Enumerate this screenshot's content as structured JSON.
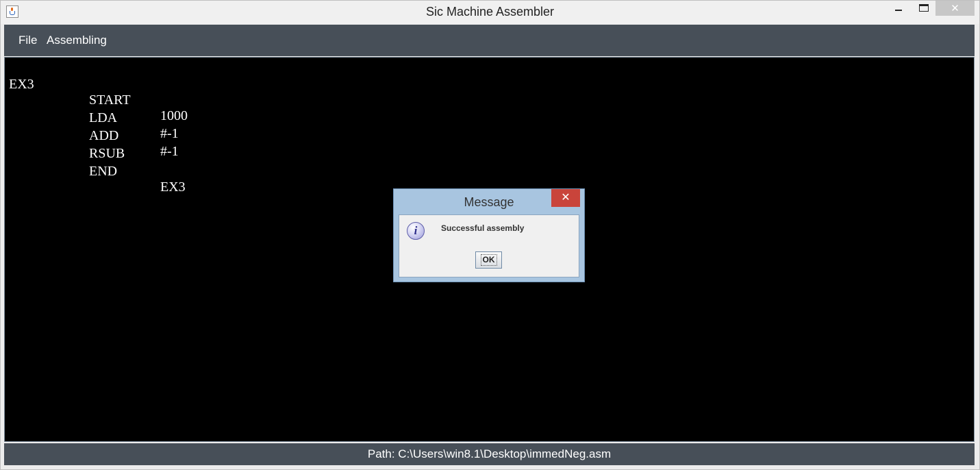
{
  "window": {
    "title": "Sic Machine Assembler",
    "close_glyph": "✕",
    "app_icon": "java-cup-icon"
  },
  "menu": {
    "items": [
      "File",
      "Assembling"
    ]
  },
  "editor": {
    "lines": [
      [
        "EX3",
        "START",
        "1000"
      ],
      [
        "",
        "LDA",
        "#-1"
      ],
      [
        "",
        "ADD",
        "#-1"
      ],
      [
        "",
        "RSUB",
        ""
      ],
      [
        "",
        "END",
        "EX3"
      ]
    ]
  },
  "status": {
    "path": "Path: C:\\Users\\win8.1\\Desktop\\immedNeg.asm"
  },
  "dialog": {
    "title": "Message",
    "message": "Successful assembly",
    "ok_label": "OK",
    "close_glyph": "✕",
    "icon": "info-icon",
    "icon_glyph": "i"
  }
}
